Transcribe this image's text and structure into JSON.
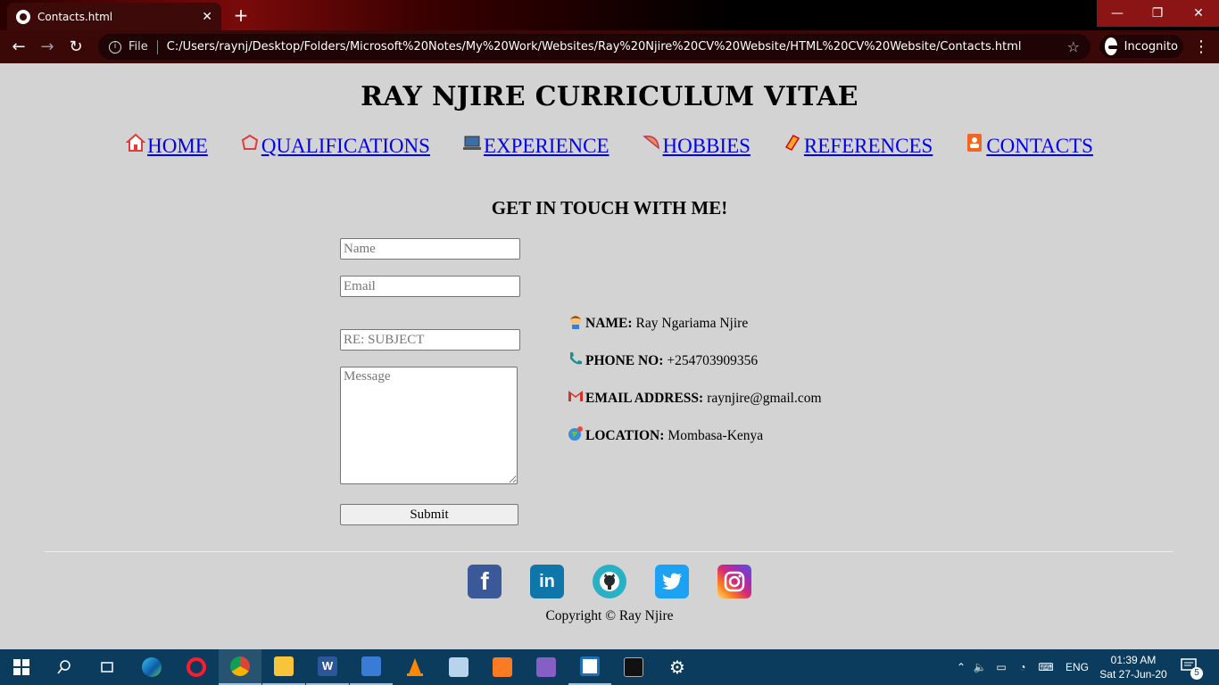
{
  "browser": {
    "tab_title": "Contacts.html",
    "tab_close": "✕",
    "new_tab": "+",
    "address_prefix": "File",
    "url": "C:/Users/raynj/Desktop/Folders/Microsoft%20Notes/My%20Work/Websites/Ray%20Njire%20CV%20Website/HTML%20CV%20Website/Contacts.html",
    "incognito_label": "Incognito",
    "window_controls": {
      "minimize": "—",
      "restore": "❐",
      "close": "✕"
    }
  },
  "site": {
    "title": "RAY NJIRE CURRICULUM VITAE",
    "nav": [
      {
        "label": "HOME",
        "icon": "home-icon"
      },
      {
        "label": "QUALIFICATIONS",
        "icon": "graduation-icon"
      },
      {
        "label": "EXPERIENCE",
        "icon": "laptop-icon"
      },
      {
        "label": "HOBBIES",
        "icon": "hobbies-icon"
      },
      {
        "label": "REFERENCES",
        "icon": "references-icon"
      },
      {
        "label": "CONTACTS",
        "icon": "contacts-icon"
      }
    ],
    "heading": "GET IN TOUCH WITH ME!",
    "form": {
      "name_placeholder": "Name",
      "email_placeholder": "Email",
      "subject_placeholder": "RE: SUBJECT",
      "message_placeholder": "Message",
      "submit_label": "Submit"
    },
    "contact_info": [
      {
        "label": "NAME:",
        "value": "Ray Ngariama Njire",
        "icon": "person-icon"
      },
      {
        "label": "PHONE NO:",
        "value": "+254703909356",
        "icon": "phone-icon"
      },
      {
        "label": "EMAIL ADDRESS:",
        "value": "raynjire@gmail.com",
        "icon": "gmail-icon"
      },
      {
        "label": "LOCATION:",
        "value": "Mombasa-Kenya",
        "icon": "globe-icon"
      }
    ],
    "socials": [
      "facebook-icon",
      "linkedin-icon",
      "github-icon",
      "twitter-icon",
      "instagram-icon"
    ],
    "copyright": "Copyright © Ray Njire"
  },
  "taskbar": {
    "language": "ENG",
    "time": "01:39 AM",
    "date": "Sat 27-Jun-20",
    "notification_count": "5"
  }
}
